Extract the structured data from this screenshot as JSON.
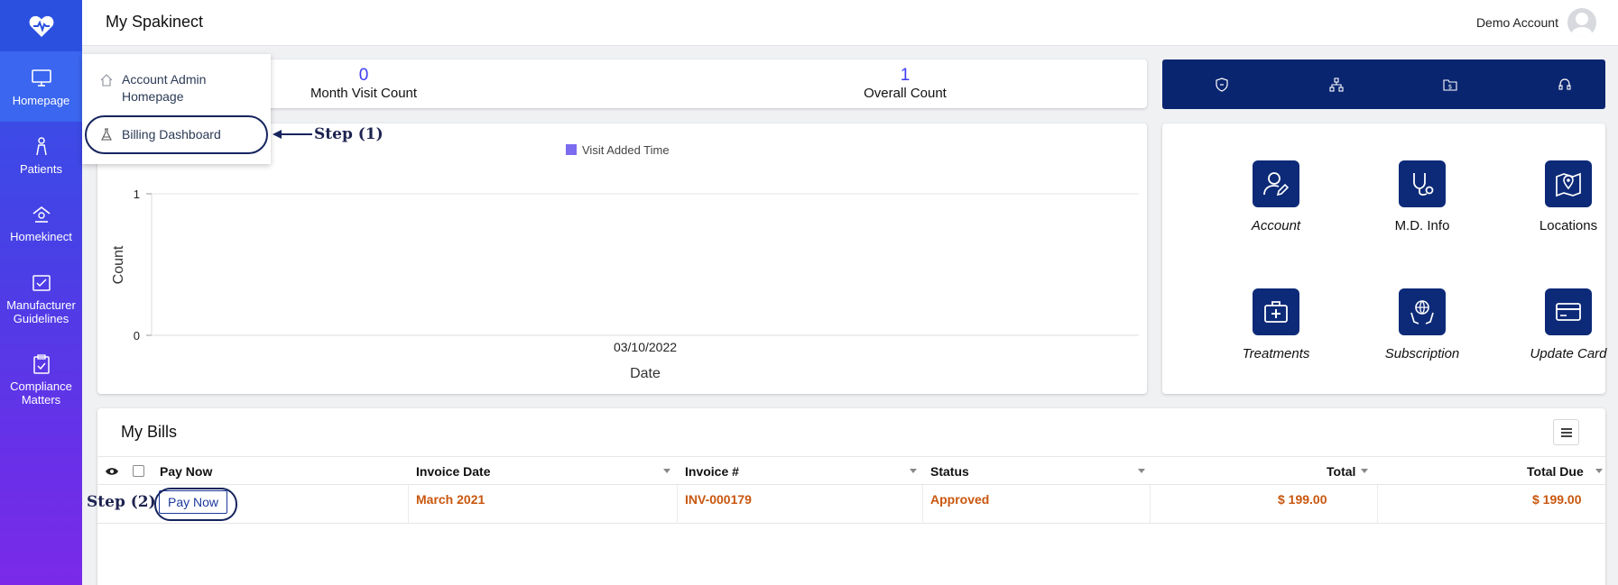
{
  "sidebar": {
    "items": [
      {
        "label": "Homepage",
        "icon": "monitor-icon",
        "active": true
      },
      {
        "label": "Patients",
        "icon": "person-icon"
      },
      {
        "label": "Homekinect",
        "icon": "home-icon"
      },
      {
        "label": "Manufacturer Guidelines",
        "icon": "checklist-icon"
      },
      {
        "label": "Compliance Matters",
        "icon": "clipboard-check-icon"
      }
    ]
  },
  "header": {
    "title": "My Spakinect",
    "account_name": "Demo Account"
  },
  "dropdown": {
    "item1": "Account Admin Homepage",
    "item2": "Billing Dashboard"
  },
  "annotations": {
    "step1": "Step (1)",
    "step2": "Step (2)"
  },
  "stats": {
    "month_visit_value": "0",
    "month_visit_label": "Month Visit Count",
    "overall_value": "1",
    "overall_label": "Overall Count"
  },
  "quick_icons": [
    "shield-icon",
    "hierarchy-icon",
    "dollar-folder-icon",
    "headset-icon"
  ],
  "chart_data": {
    "type": "bar",
    "legend": [
      "Visit Added Time"
    ],
    "categories": [
      "03/10/2022"
    ],
    "series": [
      {
        "name": "Visit Added Time",
        "values": [
          0
        ]
      }
    ],
    "xlabel": "Date",
    "ylabel": "Count",
    "y_ticks": [
      "0",
      "1"
    ],
    "ylim": [
      0,
      1
    ],
    "colors": {
      "legend": "#7b6cf0"
    }
  },
  "tiles": [
    {
      "label": "Account",
      "icon": "user-edit-icon",
      "italic": true
    },
    {
      "label": "M.D. Info",
      "icon": "stethoscope-icon",
      "italic": false
    },
    {
      "label": "Locations",
      "icon": "map-pin-icon",
      "italic": false
    },
    {
      "label": "Treatments",
      "icon": "medical-kit-icon",
      "italic": true
    },
    {
      "label": "Subscription",
      "icon": "globe-hands-icon",
      "italic": true
    },
    {
      "label": "Update Card",
      "icon": "credit-card-icon",
      "italic": true
    }
  ],
  "bills": {
    "title": "My Bills",
    "columns": [
      "Pay Now",
      "Invoice Date",
      "Invoice #",
      "Status",
      "Total",
      "Total Due"
    ],
    "rows": [
      {
        "pay_label": "Pay Now",
        "invoice_date": "March 2021",
        "invoice_no": "INV-000179",
        "status": "Approved",
        "total": "$ 199.00",
        "total_due": "$ 199.00"
      }
    ]
  },
  "colors": {
    "navy": "#0a2570",
    "accent_orange": "#c9570f",
    "stat_blue": "#3d3df0"
  }
}
